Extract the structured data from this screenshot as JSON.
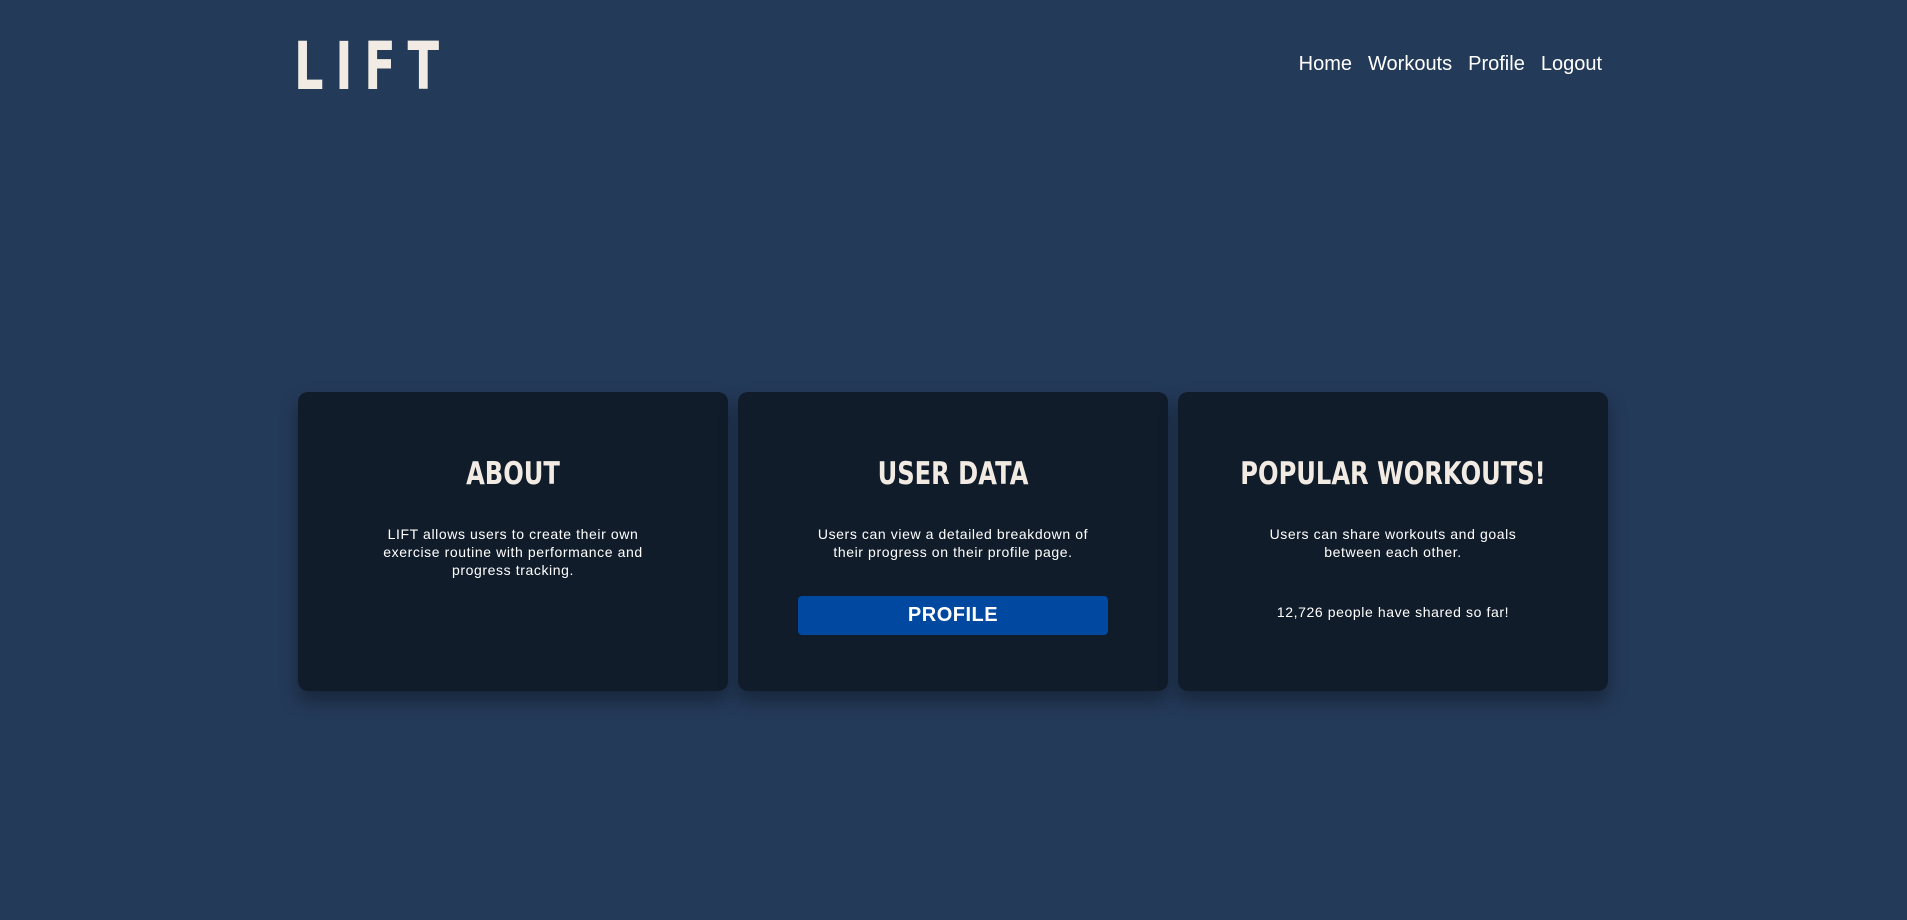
{
  "header": {
    "logo": "LIFT",
    "nav": [
      {
        "label": "Home"
      },
      {
        "label": "Workouts"
      },
      {
        "label": "Profile"
      },
      {
        "label": "Logout"
      }
    ]
  },
  "cards": {
    "about": {
      "title": "ABOUT",
      "text": "LIFT allows users to create their own exercise routine with performance and progress tracking."
    },
    "user_data": {
      "title": "USER DATA",
      "text": "Users can view a detailed breakdown of their progress on their profile page.",
      "button_label": "PROFILE"
    },
    "popular": {
      "title": "POPULAR WORKOUTS!",
      "text": "Users can share workouts and goals between each other.",
      "shared_text": "12,726 people have shared so far!"
    }
  },
  "colors": {
    "background": "#243a59",
    "card": "#111c2a",
    "accent_button": "#0048a0",
    "heading": "#f1ebe3"
  }
}
